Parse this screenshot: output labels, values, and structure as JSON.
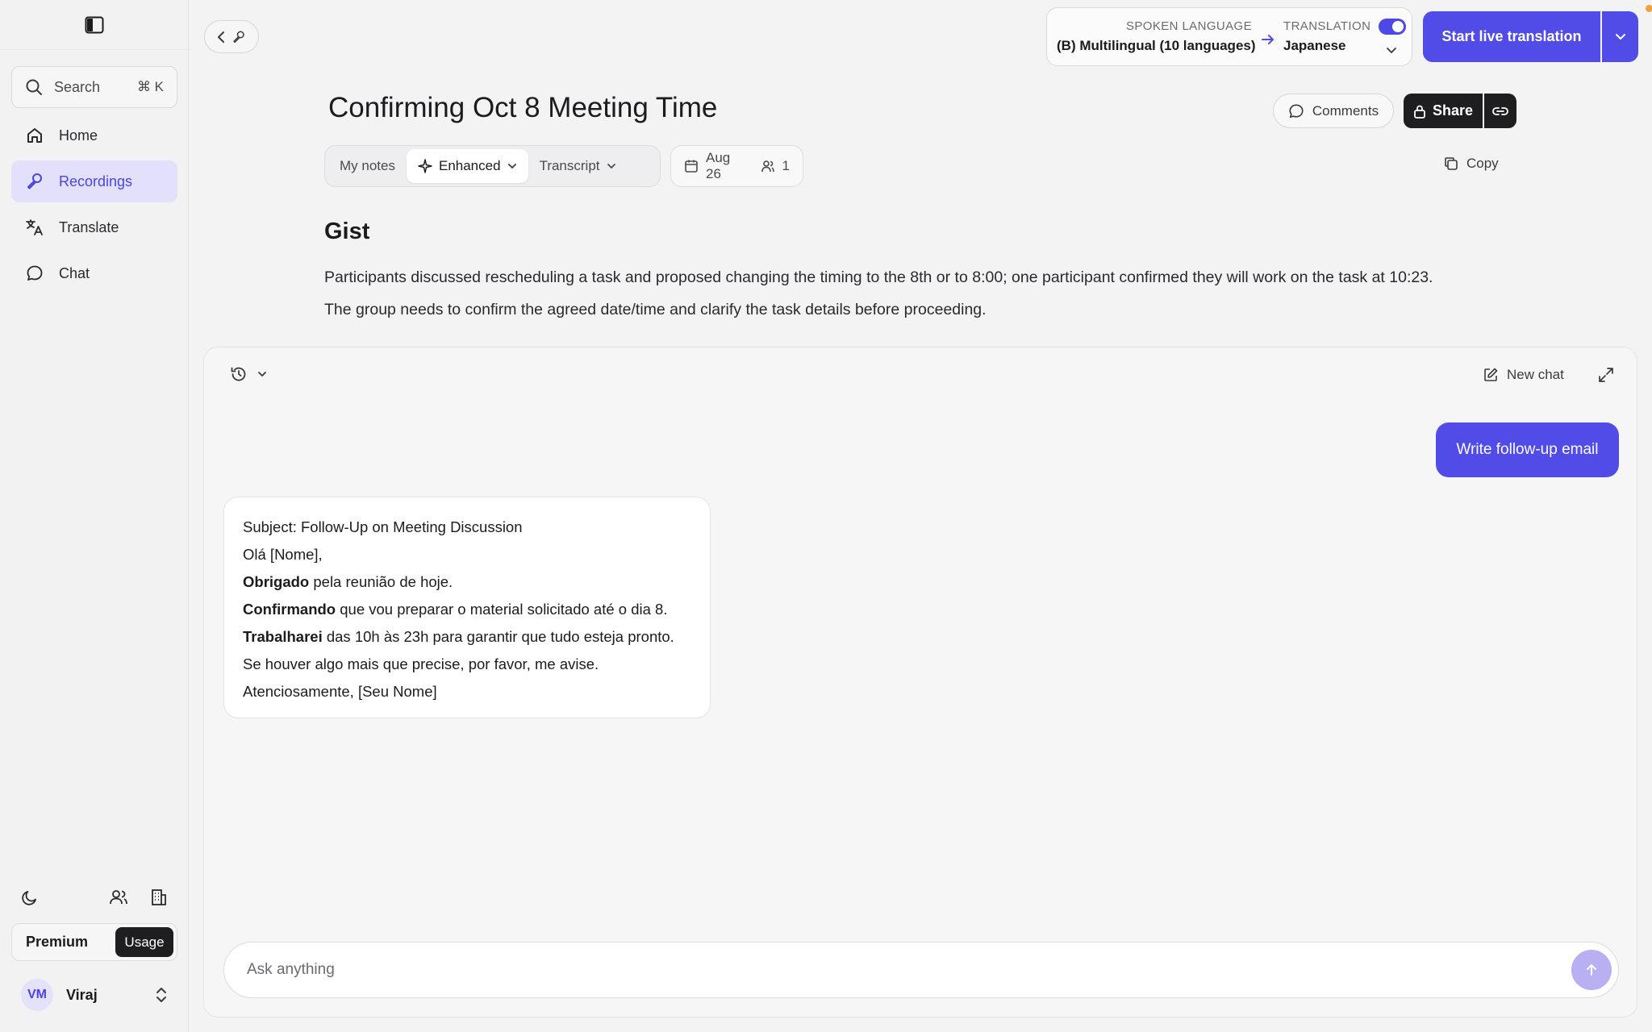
{
  "sidebar": {
    "search": {
      "label": "Search",
      "shortcut": "⌘ K"
    },
    "items": [
      {
        "label": "Home",
        "icon": "home-icon",
        "active": false
      },
      {
        "label": "Recordings",
        "icon": "microphone-icon",
        "active": true
      },
      {
        "label": "Translate",
        "icon": "translate-icon",
        "active": false
      },
      {
        "label": "Chat",
        "icon": "chat-bubble-icon",
        "active": false
      }
    ],
    "plan": {
      "name": "Premium",
      "usage_label": "Usage"
    },
    "user": {
      "initials": "VM",
      "name": "Viraj"
    }
  },
  "topbar": {
    "spoken_language_label": "SPOKEN LANGUAGE",
    "spoken_language_value": "(B) Multilingual (10 languages)",
    "translation_label": "TRANSLATION",
    "translation_value": "Japanese",
    "translation_enabled": true,
    "start_button": "Start live translation"
  },
  "document": {
    "title": "Confirming Oct 8 Meeting Time",
    "comments_label": "Comments",
    "share_label": "Share",
    "tabs": [
      {
        "label": "My notes",
        "active": false
      },
      {
        "label": "Enhanced",
        "active": true
      },
      {
        "label": "Transcript",
        "active": false
      }
    ],
    "date": "Aug 26",
    "participants": "1",
    "copy_label": "Copy",
    "gist_heading": "Gist",
    "gist_lines": [
      "Participants discussed rescheduling a task and proposed changing the timing to the 8th or to 8:00; one participant confirmed they will work on the task at 10:23.",
      "The group needs to confirm the agreed date/time and clarify the task details before proceeding."
    ]
  },
  "chat": {
    "new_chat_label": "New chat",
    "user_message": "Write follow-up email",
    "reply": {
      "line1": "Subject: Follow-Up on Meeting Discussion",
      "line2": "Olá [Nome],",
      "line3_bold": "Obrigado",
      "line3_rest": " pela reunião de hoje.",
      "line4_bold": "Confirmando",
      "line4_rest": " que vou preparar o material solicitado até o dia 8.",
      "line5_bold": "Trabalharei",
      "line5_rest": " das 10h às 23h para garantir que tudo esteja pronto.",
      "line6": "Se houver algo mais que precise, por favor, me avise.",
      "line7": "Atenciosamente, [Seu Nome]"
    },
    "input_placeholder": "Ask anything"
  },
  "colors": {
    "accent": "#514be8",
    "accent_light": "#e2e0fb",
    "dark": "#1e1e20",
    "background": "#f3f3f4"
  }
}
